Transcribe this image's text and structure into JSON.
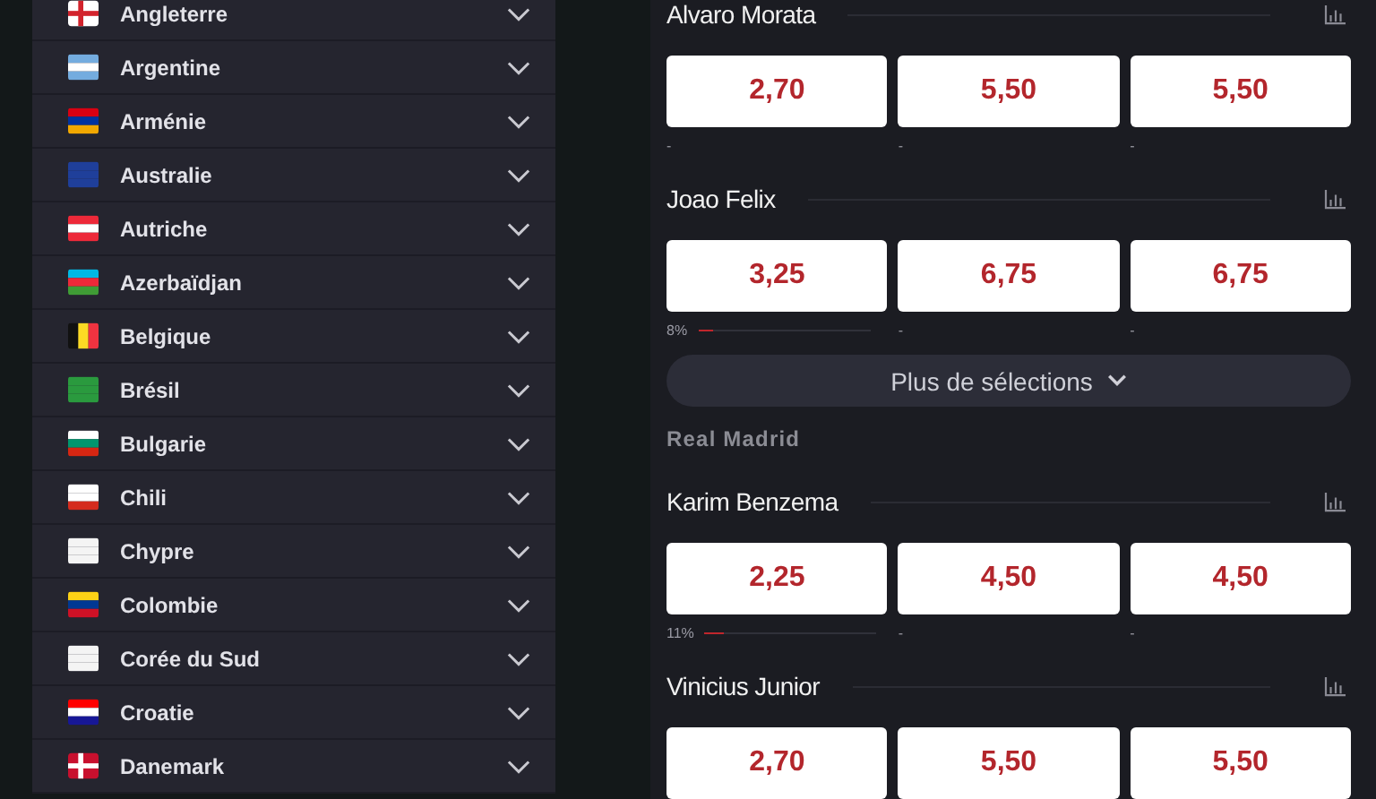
{
  "countries": [
    {
      "name": "Angleterre"
    },
    {
      "name": "Argentine"
    },
    {
      "name": "Arménie"
    },
    {
      "name": "Australie"
    },
    {
      "name": "Autriche"
    },
    {
      "name": "Azerbaïdjan"
    },
    {
      "name": "Belgique"
    },
    {
      "name": "Brésil"
    },
    {
      "name": "Bulgarie"
    },
    {
      "name": "Chili"
    },
    {
      "name": "Chypre"
    },
    {
      "name": "Colombie"
    },
    {
      "name": "Corée du Sud"
    },
    {
      "name": "Croatie"
    },
    {
      "name": "Danemark"
    }
  ],
  "markets": [
    {
      "kind": "player",
      "name": "Alvaro Morata",
      "odds": [
        "2,70",
        "5,50",
        "5,50"
      ],
      "stats": [
        {
          "label": "-"
        },
        {
          "label": "-"
        },
        {
          "label": "-"
        }
      ]
    },
    {
      "kind": "player",
      "name": "Joao Felix",
      "odds": [
        "3,25",
        "6,75",
        "6,75"
      ],
      "stats": [
        {
          "label": "8%",
          "level": 0.08
        },
        {
          "label": "-"
        },
        {
          "label": "-"
        }
      ]
    },
    {
      "kind": "more",
      "label": "Plus de sélections"
    },
    {
      "kind": "team",
      "label": "Real Madrid"
    },
    {
      "kind": "player",
      "name": "Karim Benzema",
      "odds": [
        "2,25",
        "4,50",
        "4,50"
      ],
      "stats": [
        {
          "label": "11%",
          "level": 0.11
        },
        {
          "label": "-"
        },
        {
          "label": "-"
        }
      ]
    },
    {
      "kind": "player",
      "name": "Vinicius Junior",
      "odds": [
        "2,70",
        "5,50",
        "5,50"
      ]
    }
  ]
}
